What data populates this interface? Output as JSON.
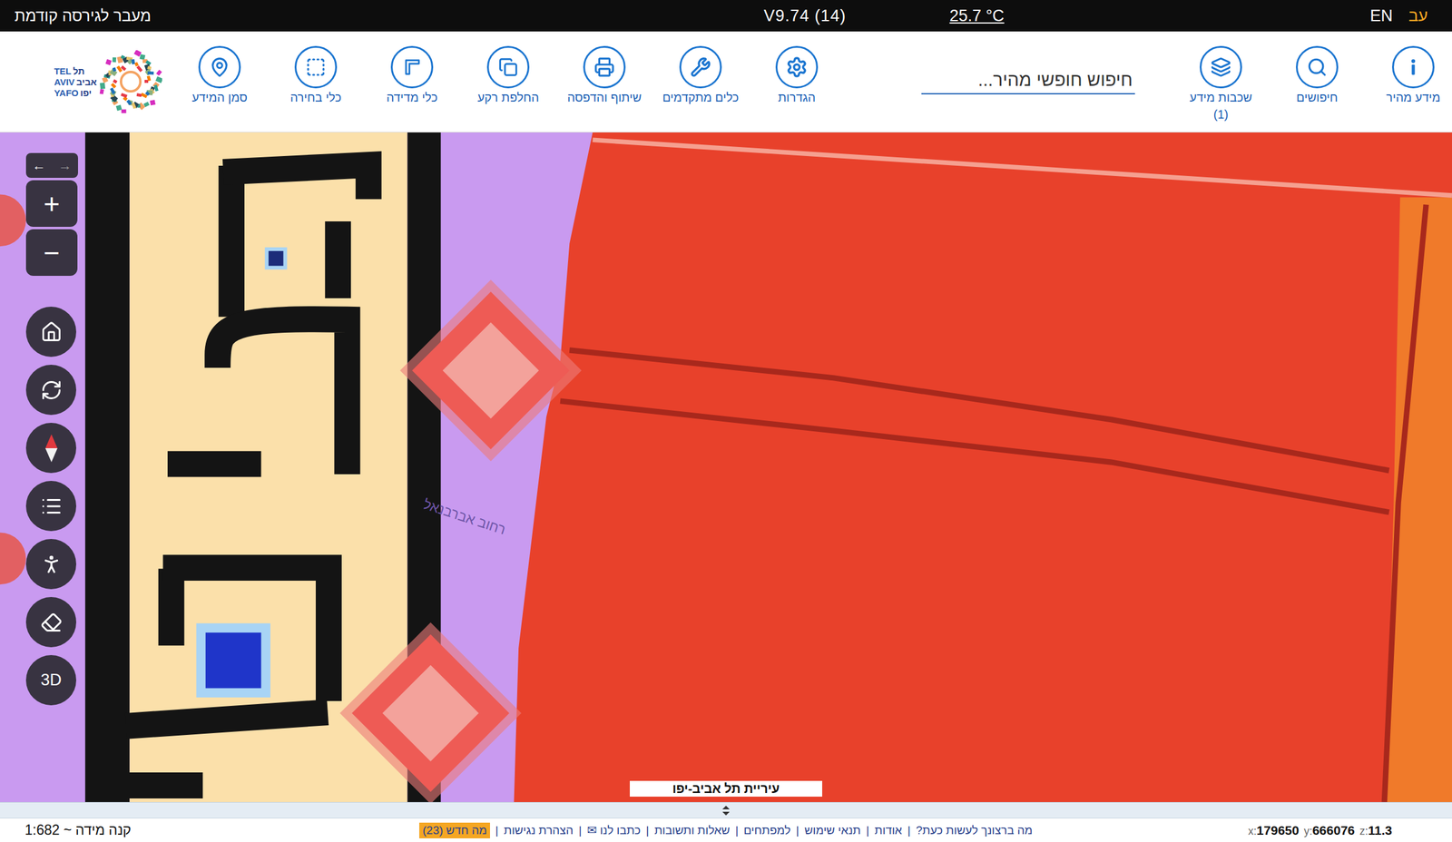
{
  "top_bar": {
    "previous_version_link": "מעבר לגירסה קודמת",
    "version": "V9.74 (14)",
    "temperature": "25.7 °C",
    "languages": [
      {
        "label": "EN",
        "selected": false
      },
      {
        "label": "עב",
        "selected": true
      }
    ]
  },
  "logo": {
    "lines": [
      {
        "latin": "TEL",
        "hebrew": "תל"
      },
      {
        "latin": "AVIV",
        "hebrew": "אביב"
      },
      {
        "latin": "YAFO",
        "hebrew": "יפו"
      }
    ]
  },
  "toolbar": {
    "right_tools": [
      {
        "label": "מידע מהיר",
        "count": ""
      },
      {
        "label": "חיפושים",
        "count": ""
      },
      {
        "label": "שכבות מידע",
        "count": "(1)"
      }
    ],
    "search": {
      "placeholder": "חיפוש חופשי מהיר..."
    },
    "left_tools": [
      {
        "label": "הגדרות"
      },
      {
        "label": "כלים מתקדמים"
      },
      {
        "label": "שיתוף והדפסה"
      },
      {
        "label": "החלפת רקע"
      },
      {
        "label": "כלי מדידה"
      },
      {
        "label": "כלי בחירה"
      },
      {
        "label": "סמן המידע"
      }
    ]
  },
  "map_controls": {
    "history": [
      {
        "label": "←",
        "disabled": false
      },
      {
        "label": "→",
        "disabled": true
      }
    ],
    "zoom": [
      "+",
      "−"
    ],
    "mode_3d": "3D"
  },
  "map": {
    "street_label": "רחוב אברבנאל",
    "attribution": "עיריית תל אביב-יפו"
  },
  "status_bar": {
    "scale": "קנה מידה ~ 1:682",
    "separator": "|",
    "links": [
      {
        "label": "מה ברצונך לעשות כעת?",
        "highlighted": false
      },
      {
        "label": "אודות",
        "highlighted": false
      },
      {
        "label": "תנאי שימוש",
        "highlighted": false
      },
      {
        "label": "למפתחים",
        "highlighted": false
      },
      {
        "label": "שאלות ותשובות",
        "highlighted": false
      },
      {
        "label": "כתבו לנו ✉",
        "highlighted": false
      },
      {
        "label": "הצהרת נגישות",
        "highlighted": false
      },
      {
        "label": "מה חדש (23)",
        "highlighted": true
      }
    ],
    "coordinates": [
      {
        "axis": "x:",
        "value": "179650"
      },
      {
        "axis": "y:",
        "value": "666076"
      },
      {
        "axis": "z:",
        "value": "11.3"
      }
    ]
  }
}
